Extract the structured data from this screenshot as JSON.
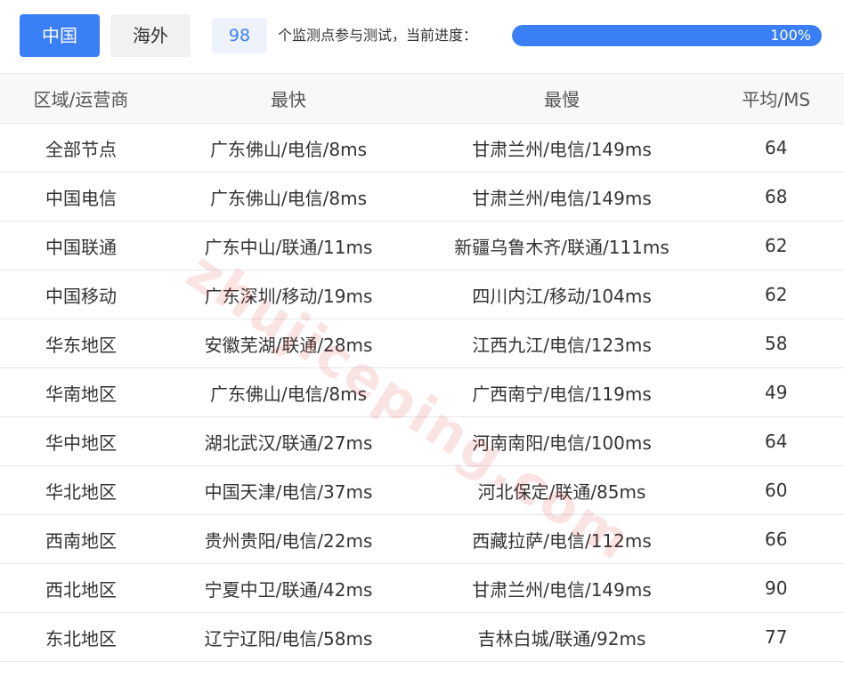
{
  "tabs": [
    {
      "label": "中国",
      "active": true
    },
    {
      "label": "海外",
      "active": false
    }
  ],
  "monitor": {
    "count": "98",
    "text": "个监测点参与测试，当前进度：",
    "progress_percent": 100,
    "progress_label": "100%"
  },
  "colors": {
    "accent": "#3a7ff5",
    "header_bg": "#f7f8fa",
    "border": "#e5e7eb"
  },
  "table": {
    "headers": [
      "区域/运营商",
      "最快",
      "最慢",
      "平均/MS"
    ],
    "rows": [
      [
        "全部节点",
        "广东佛山/电信/8ms",
        "甘肃兰州/电信/149ms",
        "64"
      ],
      [
        "中国电信",
        "广东佛山/电信/8ms",
        "甘肃兰州/电信/149ms",
        "68"
      ],
      [
        "中国联通",
        "广东中山/联通/11ms",
        "新疆乌鲁木齐/联通/111ms",
        "62"
      ],
      [
        "中国移动",
        "广东深圳/移动/19ms",
        "四川内江/移动/104ms",
        "62"
      ],
      [
        "华东地区",
        "安徽芜湖/联通/28ms",
        "江西九江/电信/123ms",
        "58"
      ],
      [
        "华南地区",
        "广东佛山/电信/8ms",
        "广西南宁/电信/119ms",
        "49"
      ],
      [
        "华中地区",
        "湖北武汉/联通/27ms",
        "河南南阳/电信/100ms",
        "64"
      ],
      [
        "华北地区",
        "中国天津/电信/37ms",
        "河北保定/联通/85ms",
        "60"
      ],
      [
        "西南地区",
        "贵州贵阳/电信/22ms",
        "西藏拉萨/电信/112ms",
        "66"
      ],
      [
        "西北地区",
        "宁夏中卫/联通/42ms",
        "甘肃兰州/电信/149ms",
        "90"
      ],
      [
        "东北地区",
        "辽宁辽阳/电信/58ms",
        "吉林白城/联通/92ms",
        "77"
      ]
    ]
  },
  "watermark": "zhujiceping.com"
}
